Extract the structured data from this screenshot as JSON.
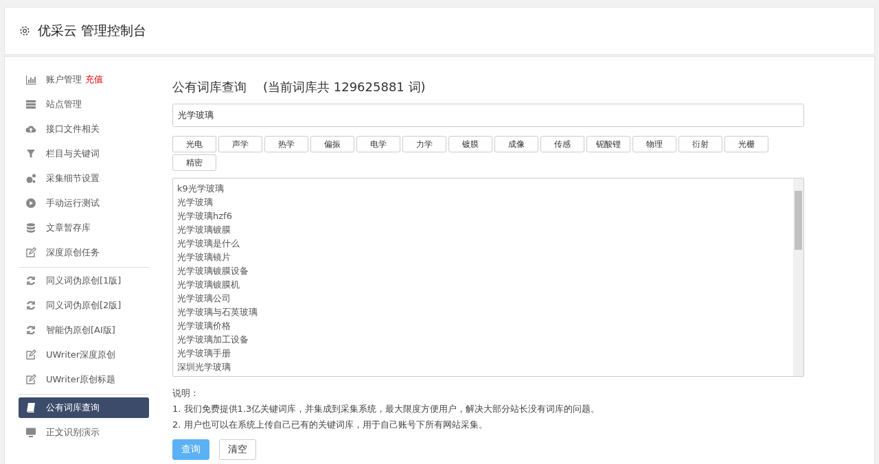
{
  "header": {
    "title": "优采云 管理控制台"
  },
  "sidebar": {
    "groups": [
      [
        {
          "label": "账户管理",
          "badge": "充值",
          "selected": false
        },
        {
          "label": "站点管理",
          "selected": false
        },
        {
          "label": "接口文件相关",
          "selected": false
        },
        {
          "label": "栏目与关键词",
          "selected": false
        },
        {
          "label": "采集细节设置",
          "selected": false
        },
        {
          "label": "手动运行测试",
          "selected": false
        },
        {
          "label": "文章暂存库",
          "selected": false
        },
        {
          "label": "深度原创任务",
          "selected": false
        }
      ],
      [
        {
          "label": "同义词伪原创[1版]",
          "selected": false
        },
        {
          "label": "同义词伪原创[2版]",
          "selected": false
        },
        {
          "label": "智能伪原创[AI版]",
          "selected": false
        },
        {
          "label": "UWriter深度原创",
          "selected": false
        },
        {
          "label": "UWriter原创标题",
          "selected": false
        }
      ],
      [
        {
          "label": "公有词库查询",
          "selected": true
        },
        {
          "label": "正文识别演示",
          "selected": false
        }
      ]
    ]
  },
  "main": {
    "title": "公有词库查询",
    "count_note": "(当前词库共 129625881 词)",
    "search": {
      "value": "光学玻璃"
    },
    "tags": [
      "光电",
      "声学",
      "热学",
      "偏振",
      "电学",
      "力学",
      "镀膜",
      "成像",
      "传感",
      "铌酸锂",
      "物理",
      "衍射",
      "光栅",
      "精密"
    ],
    "results": [
      "k9光学玻璃",
      "光学玻璃",
      "光学玻璃hzf6",
      "光学玻璃镀膜",
      "光学玻璃是什么",
      "光学玻璃镜片",
      "光学玻璃镀膜设备",
      "光学玻璃镀膜机",
      "光学玻璃公司",
      "光学玻璃与石英玻璃",
      "光学玻璃价格",
      "光学玻璃加工设备",
      "光学玻璃手册",
      "深圳光学玻璃"
    ],
    "notes": {
      "heading": "说明：",
      "lines": [
        "1. 我们免费提供1.3亿关键词库，并集成到采集系统，最大限度方便用户，解决大部分站长没有词库的问题。",
        "2. 用户也可以在系统上传自己已有的关键词库，用于自己账号下所有网站采集。"
      ]
    },
    "buttons": [
      {
        "kind": "primary",
        "label": "查询"
      },
      {
        "kind": "default",
        "label": "清空"
      }
    ]
  }
}
